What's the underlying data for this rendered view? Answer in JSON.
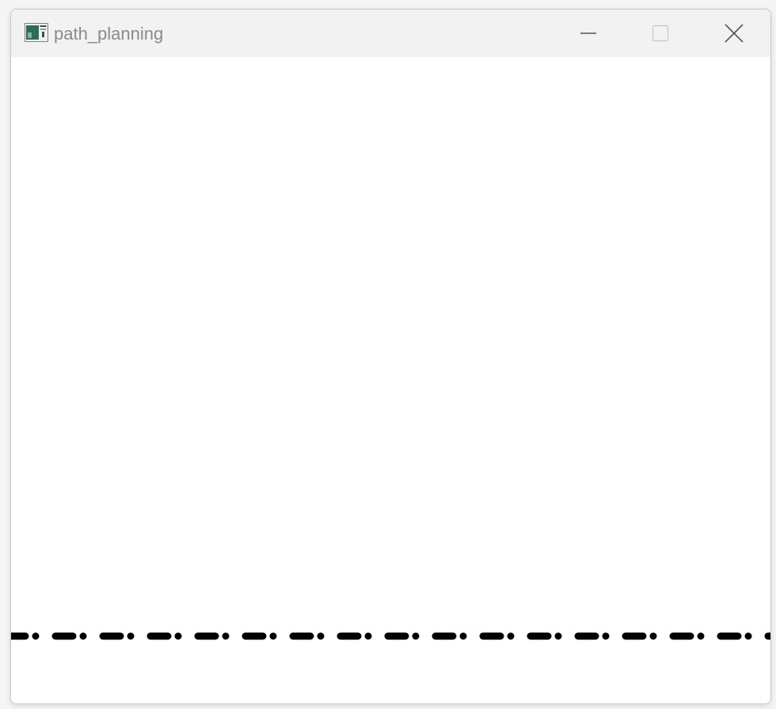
{
  "window": {
    "title": "path_planning",
    "app_icon": "app-window-icon",
    "controls": {
      "minimize_icon": "minimize-icon",
      "maximize_icon": "maximize-icon",
      "maximize_enabled": false,
      "close_icon": "close-icon"
    }
  },
  "canvas": {
    "background": "#ffffff",
    "path": {
      "style": "dash-dot",
      "color": "#000000",
      "orientation": "horizontal"
    }
  }
}
